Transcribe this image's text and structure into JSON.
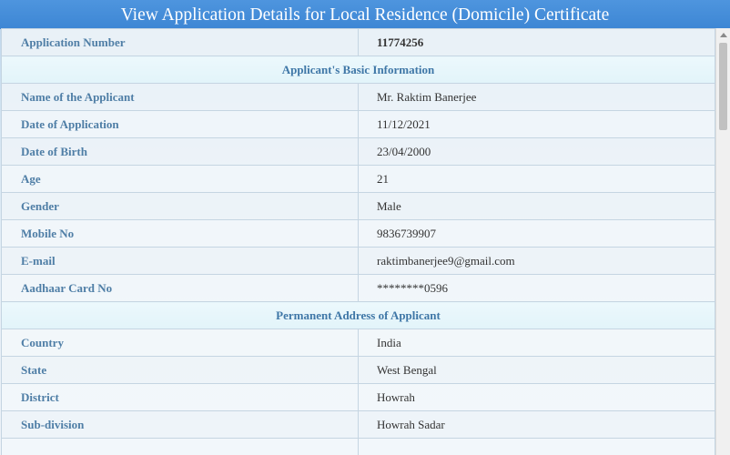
{
  "header": {
    "title": "View Application Details for Local Residence (Domicile) Certificate"
  },
  "rows": [
    {
      "type": "row",
      "label": "Application Number",
      "value": "11774256",
      "bold": true
    },
    {
      "type": "section",
      "title": "Applicant's Basic Information"
    },
    {
      "type": "row",
      "label": "Name of the Applicant",
      "value": "Mr. Raktim Banerjee"
    },
    {
      "type": "row",
      "label": "Date of Application",
      "value": "11/12/2021"
    },
    {
      "type": "row",
      "label": "Date of Birth",
      "value": "23/04/2000"
    },
    {
      "type": "row",
      "label": "Age",
      "value": "21"
    },
    {
      "type": "row",
      "label": "Gender",
      "value": "Male"
    },
    {
      "type": "row",
      "label": "Mobile No",
      "value": "9836739907"
    },
    {
      "type": "row",
      "label": "E-mail",
      "value": "raktimbanerjee9@gmail.com"
    },
    {
      "type": "row",
      "label": "Aadhaar Card No",
      "value": "********0596"
    },
    {
      "type": "section",
      "title": "Permanent Address of Applicant"
    },
    {
      "type": "row",
      "label": "Country",
      "value": "India"
    },
    {
      "type": "row",
      "label": "State",
      "value": "West Bengal"
    },
    {
      "type": "row",
      "label": "District",
      "value": "Howrah"
    },
    {
      "type": "row",
      "label": "Sub-division",
      "value": "Howrah Sadar"
    },
    {
      "type": "row",
      "label": "",
      "value": ""
    }
  ]
}
